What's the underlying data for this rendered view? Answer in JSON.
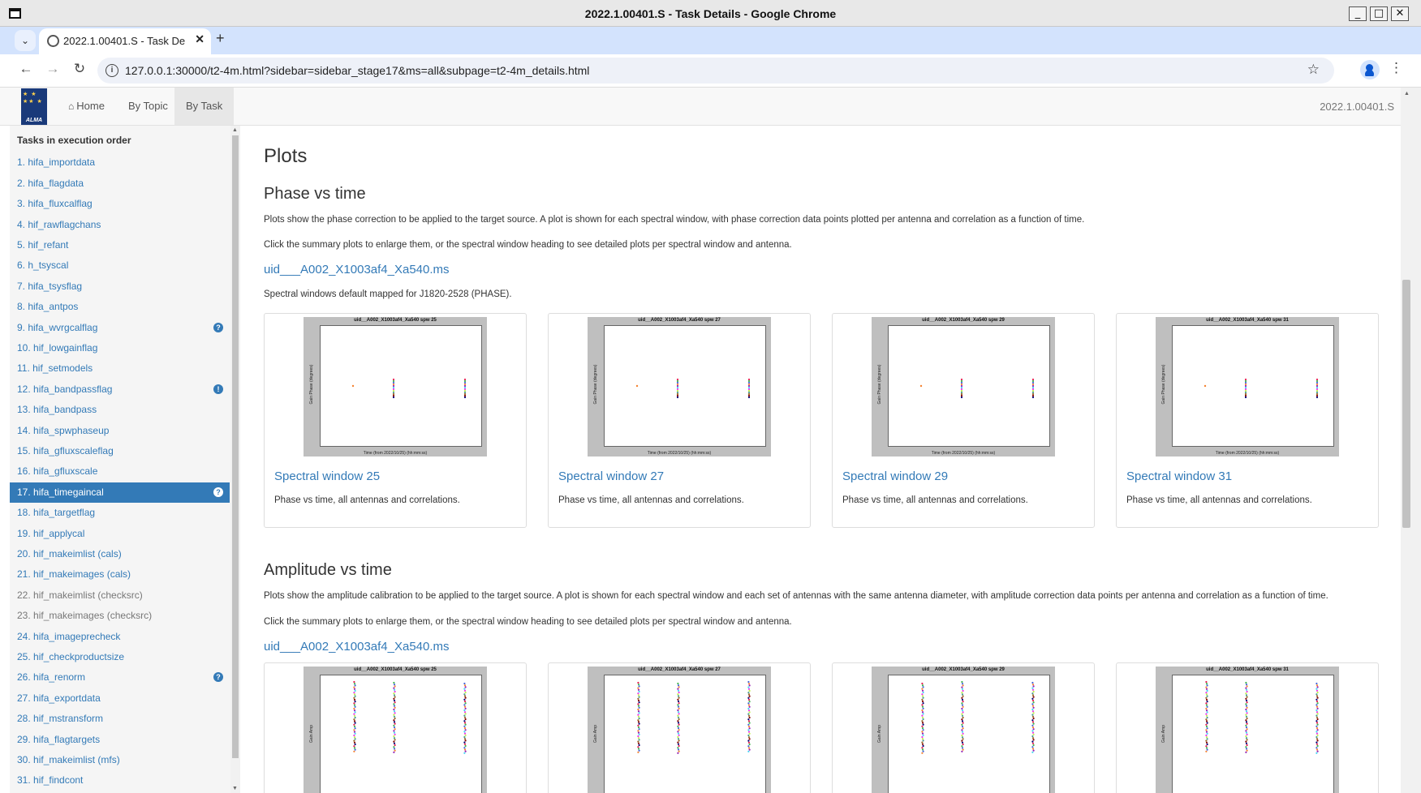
{
  "window": {
    "title": "2022.1.00401.S - Task Details - Google Chrome"
  },
  "browser": {
    "tab_title": "2022.1.00401.S - Task Det",
    "url": "127.0.0.1:30000/t2-4m.html?sidebar=sidebar_stage17&ms=all&subpage=t2-4m_details.html"
  },
  "navbar": {
    "logo_text": "ALMA",
    "links": [
      "Home",
      "By Topic",
      "By Task"
    ],
    "version": "2022.1.00401.S"
  },
  "sidebar": {
    "heading": "Tasks in execution order",
    "items": [
      {
        "label": "1. hifa_importdata",
        "badge": ""
      },
      {
        "label": "2. hifa_flagdata",
        "badge": ""
      },
      {
        "label": "3. hifa_fluxcalflag",
        "badge": ""
      },
      {
        "label": "4. hif_rawflagchans",
        "badge": ""
      },
      {
        "label": "5. hif_refant",
        "badge": ""
      },
      {
        "label": "6. h_tsyscal",
        "badge": ""
      },
      {
        "label": "7. hifa_tsysflag",
        "badge": ""
      },
      {
        "label": "8. hifa_antpos",
        "badge": ""
      },
      {
        "label": "9. hifa_wvrgcalflag",
        "badge": "?"
      },
      {
        "label": "10. hif_lowgainflag",
        "badge": ""
      },
      {
        "label": "11. hif_setmodels",
        "badge": ""
      },
      {
        "label": "12. hifa_bandpassflag",
        "badge": "!"
      },
      {
        "label": "13. hifa_bandpass",
        "badge": ""
      },
      {
        "label": "14. hifa_spwphaseup",
        "badge": ""
      },
      {
        "label": "15. hifa_gfluxscaleflag",
        "badge": ""
      },
      {
        "label": "16. hifa_gfluxscale",
        "badge": ""
      },
      {
        "label": "17. hifa_timegaincal",
        "badge": "?"
      },
      {
        "label": "18. hifa_targetflag",
        "badge": ""
      },
      {
        "label": "19. hif_applycal",
        "badge": ""
      },
      {
        "label": "20. hif_makeimlist (cals)",
        "badge": ""
      },
      {
        "label": "21. hif_makeimages (cals)",
        "badge": ""
      },
      {
        "label": "22. hif_makeimlist (checksrc)",
        "badge": ""
      },
      {
        "label": "23. hif_makeimages (checksrc)",
        "badge": ""
      },
      {
        "label": "24. hifa_imageprecheck",
        "badge": ""
      },
      {
        "label": "25. hif_checkproductsize",
        "badge": ""
      },
      {
        "label": "26. hifa_renorm",
        "badge": "?"
      },
      {
        "label": "27. hifa_exportdata",
        "badge": ""
      },
      {
        "label": "28. hif_mstransform",
        "badge": ""
      },
      {
        "label": "29. hifa_flagtargets",
        "badge": ""
      },
      {
        "label": "30. hif_makeimlist (mfs)",
        "badge": ""
      },
      {
        "label": "31. hif_findcont",
        "badge": ""
      }
    ]
  },
  "main": {
    "heading": "Plots",
    "phase": {
      "heading": "Phase vs time",
      "desc1": "Plots show the phase correction to be applied to the target source. A plot is shown for each spectral window, with phase correction data points plotted per antenna and correlation as a function of time.",
      "desc2": "Click the summary plots to enlarge them, or the spectral window heading to see detailed plots per spectral window and antenna.",
      "ms_link": "uid___A002_X1003af4_Xa540.ms",
      "mapping_note": "Spectral windows default mapped for J1820-2528 (PHASE).",
      "cards": [
        {
          "plot_title": "uid__A002_X1003af4_Xa540 spw 25",
          "title": "Spectral window 25",
          "desc": "Phase vs time, all antennas and correlations."
        },
        {
          "plot_title": "uid__A002_X1003af4_Xa540 spw 27",
          "title": "Spectral window 27",
          "desc": "Phase vs time, all antennas and correlations."
        },
        {
          "plot_title": "uid__A002_X1003af4_Xa540 spw 29",
          "title": "Spectral window 29",
          "desc": "Phase vs time, all antennas and correlations."
        },
        {
          "plot_title": "uid__A002_X1003af4_Xa540 spw 31",
          "title": "Spectral window 31",
          "desc": "Phase vs time, all antennas and correlations."
        }
      ],
      "xaxis_label": "Time (from 2022/10/25) (hh:mm:ss)",
      "yaxis_label": "Gain Phase (degrees)"
    },
    "amplitude": {
      "heading": "Amplitude vs time",
      "desc1": "Plots show the amplitude calibration to be applied to the target source. A plot is shown for each spectral window and each set of antennas with the same antenna diameter, with amplitude correction data points per antenna and correlation as a function of time.",
      "desc2": "Click the summary plots to enlarge them, or the spectral window heading to see detailed plots per spectral window and antenna.",
      "ms_link": "uid___A002_X1003af4_Xa540.ms",
      "cards": [
        {
          "plot_title": "uid__A002_X1003af4_Xa540 spw 25"
        },
        {
          "plot_title": "uid__A002_X1003af4_Xa540 spw 27"
        },
        {
          "plot_title": "uid__A002_X1003af4_Xa540 spw 29"
        },
        {
          "plot_title": "uid__A002_X1003af4_Xa540 spw 31"
        }
      ],
      "yaxis_label": "Gain Amp"
    }
  },
  "colors": {
    "link": "#337ab7",
    "active_bg": "#337ab7"
  },
  "icons": [
    "window-icon",
    "tab-menu-icon",
    "favicon-icon",
    "close-icon",
    "new-tab-icon",
    "back-icon",
    "forward-icon",
    "reload-icon",
    "info-icon",
    "star-icon",
    "profile-icon",
    "menu-icon",
    "home-icon"
  ]
}
